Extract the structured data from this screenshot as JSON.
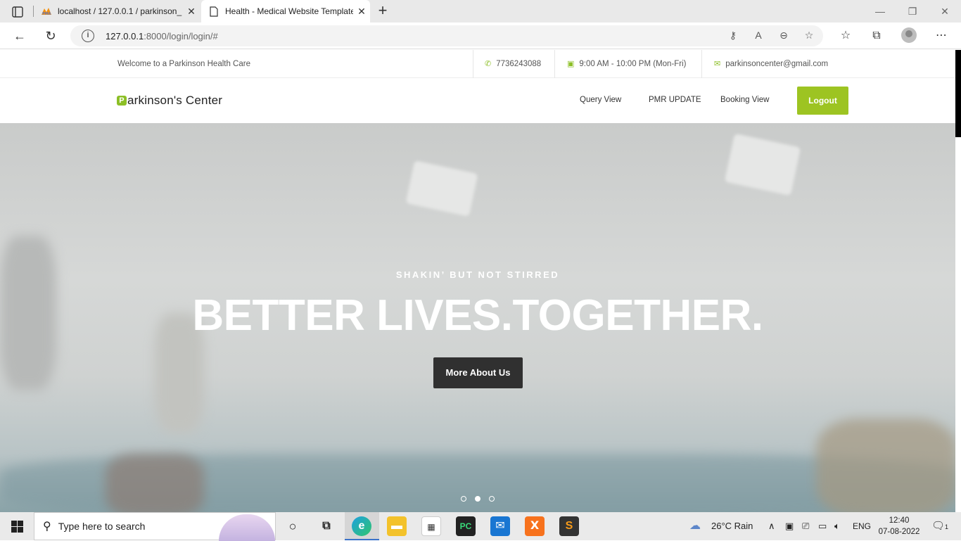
{
  "browser": {
    "tabs": [
      {
        "title": "localhost / 127.0.0.1 / parkinson_",
        "favicon": "phpmyadmin-icon"
      },
      {
        "title": "Health - Medical Website Template",
        "favicon": "document-icon"
      }
    ],
    "url_host": "127.0.0.1",
    "url_path": ":8000/login/login/#"
  },
  "topbar": {
    "welcome": "Welcome to a Parkinson Health Care",
    "phone": "7736243088",
    "hours": "9:00 AM - 10:00 PM (Mon-Fri)",
    "email": "parkinsoncenter@gmail.com"
  },
  "nav": {
    "logo_initial": "P",
    "logo_rest": "arkinson's Center",
    "links": [
      "Query View",
      "PMR UPDATE",
      "Booking View"
    ],
    "logout": "Logout"
  },
  "hero": {
    "tagline": "SHAKIN’ BUT NOT STIRRED",
    "headline": "BETTER LIVES.TOGETHER.",
    "cta": "More About Us",
    "active_slide": 2,
    "slide_count": 3
  },
  "taskbar": {
    "search_placeholder": "Type here to search",
    "weather": "26°C  Rain",
    "language": "ENG",
    "time": "12:40",
    "date": "07-08-2022",
    "notifications": "1"
  },
  "colors": {
    "accent": "#9dc422",
    "button_dark": "#303030"
  }
}
